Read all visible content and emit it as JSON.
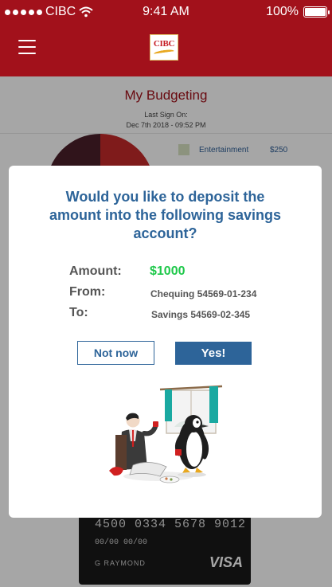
{
  "status_bar": {
    "carrier": "CIBC",
    "time": "9:41 AM",
    "battery": "100%"
  },
  "header": {
    "logo_text": "CIBC"
  },
  "page": {
    "title": "My Budgeting",
    "last_sign_on_label": "Last Sign On:",
    "last_sign_on_value": "Dec 7th 2018 - 09:52 PM"
  },
  "legend": [
    {
      "label": "Entertainment",
      "value": "$250",
      "color": "#d8e2c2"
    }
  ],
  "pie_colors": [
    "#c42a2a",
    "#e6d6cc",
    "#39a7a6",
    "#4a1f2a"
  ],
  "card": {
    "number": "4500 0334 5678 9012",
    "dates": "00/00  00/00",
    "name": "G RAYMOND",
    "network": "VISA"
  },
  "modal": {
    "question": "Would you like to deposit the amount into the following savings account?",
    "amount_label": "Amount:",
    "amount_value": "$1000",
    "from_label": "From:",
    "from_value": "Chequing 54569-01-234",
    "to_label": "To:",
    "to_value": "Savings 54569-02-345",
    "not_now_label": "Not now",
    "yes_label": "Yes!"
  },
  "colors": {
    "brand_red": "#a2111b",
    "accent_blue": "#2d6499",
    "amount_green": "#1ec84a"
  }
}
